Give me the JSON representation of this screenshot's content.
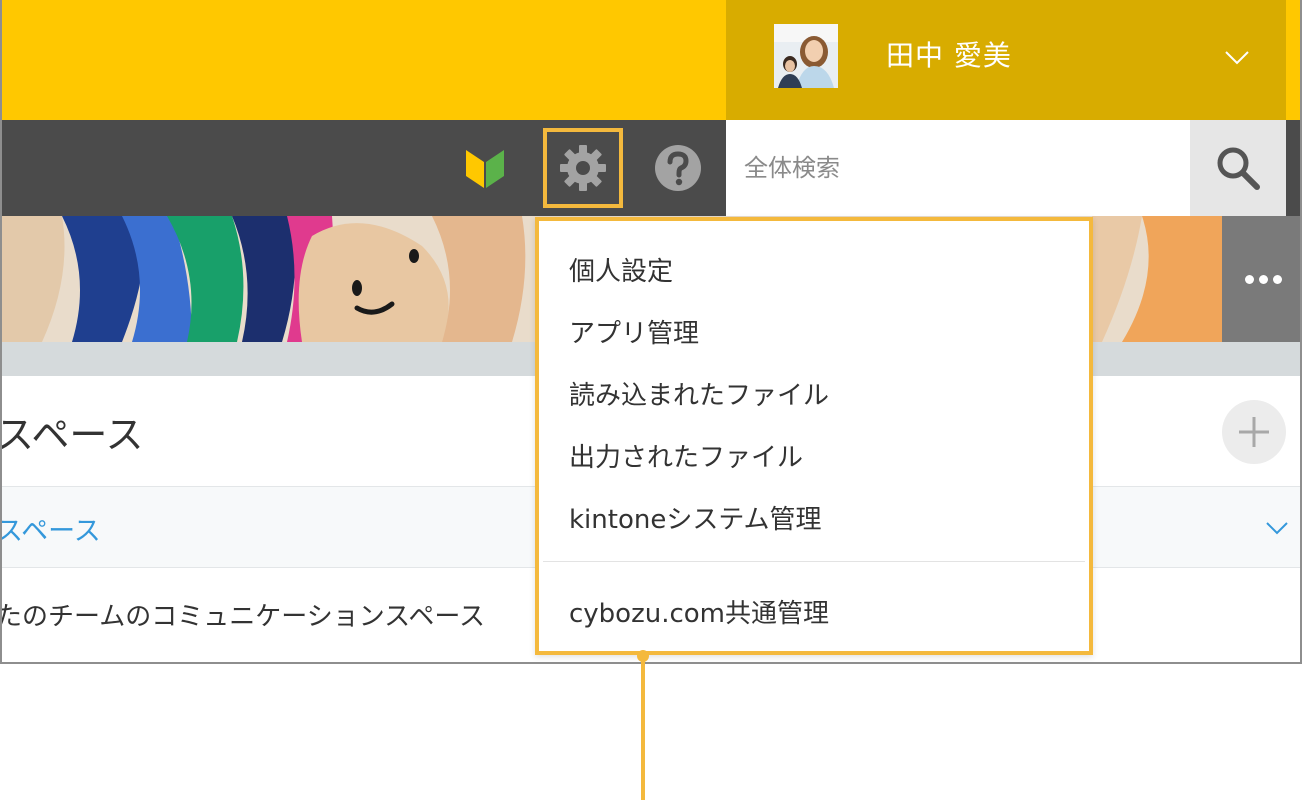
{
  "header": {
    "user_name": "田中 愛美"
  },
  "toolbar": {
    "icons": [
      "beginner-mark-icon",
      "gear-icon",
      "help-icon"
    ]
  },
  "search": {
    "placeholder": "全体検索",
    "value": ""
  },
  "settings_menu": {
    "items": [
      "個人設定",
      "アプリ管理",
      "読み込まれたファイル",
      "出力されたファイル",
      "kintoneシステム管理"
    ],
    "footer_item": "cybozu.com共通管理"
  },
  "space_panel": {
    "title": "スペース",
    "space_link": "スペース",
    "description": "たのチームのコミュニケーションスペース"
  },
  "colors": {
    "header_yellow": "#ffc800",
    "user_area": "#d8ac00",
    "toolbar": "#4b4b4b",
    "highlight": "#f4b93d",
    "link_blue": "#3498db"
  }
}
